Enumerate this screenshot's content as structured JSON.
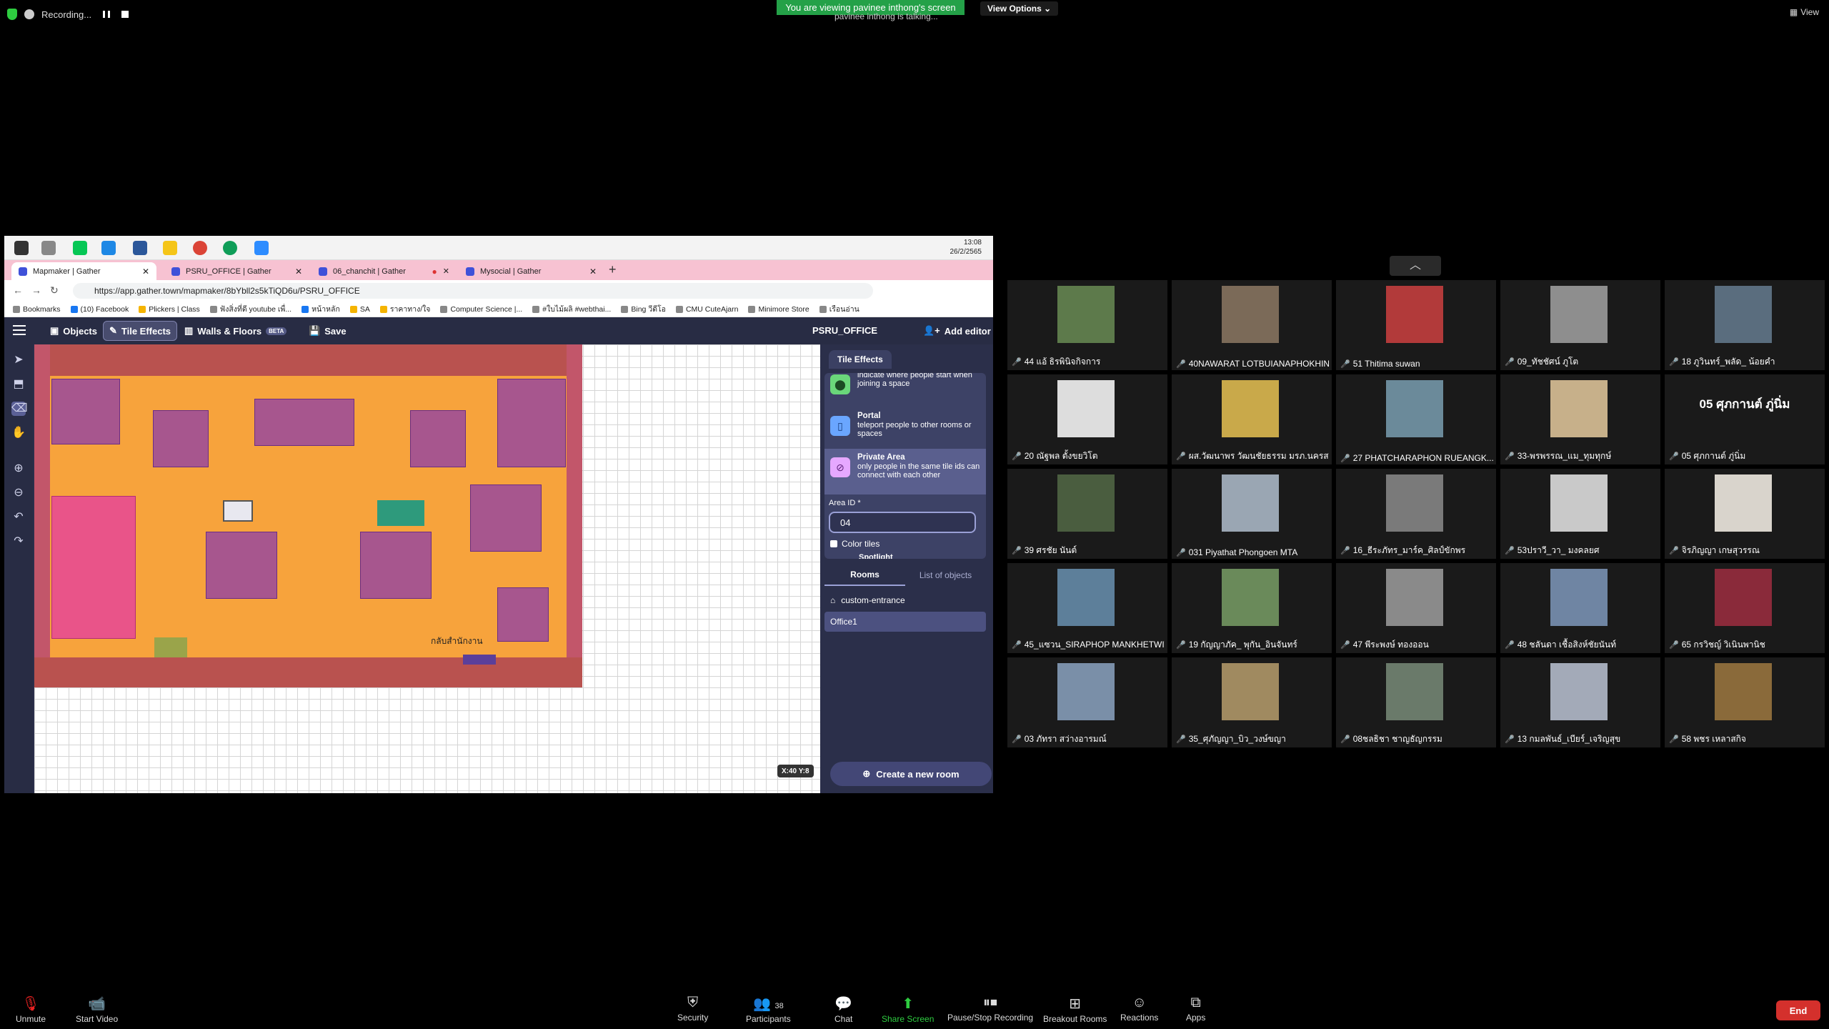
{
  "recording": {
    "label": "Recording..."
  },
  "banner": {
    "viewing": "You are viewing pavinee inthong's screen",
    "talking": "pavinee inthong is talking...",
    "view_options": "View Options ⌄",
    "view": "View"
  },
  "taskbar": {
    "time": "13:08",
    "date": "26/2/2565"
  },
  "browser": {
    "tabs": [
      {
        "label": "Mapmaker | Gather"
      },
      {
        "label": "PSRU_OFFICE | Gather"
      },
      {
        "label": "06_chanchit | Gather"
      },
      {
        "label": "Mysocial | Gather"
      }
    ],
    "url": "https://app.gather.town/mapmaker/8bYbll2s5kTiQD6u/PSRU_OFFICE",
    "bookmarks": [
      "Bookmarks",
      "(10) Facebook",
      "Plickers | Class",
      "ฟังสิ่งที่ดี youtube เพื่...",
      "หน้าหลัก",
      "SA",
      "ราคาทาง/ใจ",
      "Computer Science |...",
      "#ใบไม้ผลิ #webthai...",
      "Bing วีดีโอ",
      "CMU CuteAjarn",
      "Minimore Store",
      "เรือนอ่าน"
    ]
  },
  "gather": {
    "toolbar": {
      "objects": "Objects",
      "tile_effects": "Tile Effects",
      "walls_floors": "Walls & Floors",
      "beta": "BETA",
      "save": "Save",
      "space_name": "PSRU_OFFICE",
      "add_editor": "Add editor"
    },
    "panel": {
      "tab": "Tile Effects",
      "effects": [
        {
          "name": "",
          "desc": "indicate where people start when joining a space"
        },
        {
          "name": "Portal",
          "desc": "teleport people to other rooms or spaces"
        },
        {
          "name": "Private Area",
          "desc": "only people in the same tile ids can connect with each other"
        }
      ],
      "area_label": "Area ID *",
      "area_value": "04",
      "color_tiles": "Color tiles",
      "spotlight": "Spotlight",
      "rooms_tab": "Rooms",
      "objects_tab": "List of objects",
      "rooms": [
        "custom-entrance",
        "Office1"
      ],
      "create_room": "Create a new room"
    },
    "map": {
      "room_label": "กลับสำนักงาน",
      "coord": "X:40  Y:8"
    }
  },
  "participants": [
    "44 แอ้ ธิรพินิจกิจการ",
    "40NAWARAT LOTBUIANAPHOKHIN",
    "51 Thitima suwan",
    "09_ทัชชัศน์ ภูโต",
    "18 ภูวินทร์_พลัด_ น้อยคำ",
    "20 ณัฐพล ตั้งขยวิโต",
    "ผส.วัฒนาพร วัฒนชัยธรรม มรภ.นครส...",
    "27 PHATCHARAPHON RUEANGK...",
    "33-พรพรรณ_แม_ทุมทุกษ์",
    "05 ศุภกานต์ ภู่นิ่ม",
    "39 ศรชัย นันต์",
    "031 Piyathat Phongoen MTA",
    "16_ธีระภัทร_มาร์ค_ศิลป์ขักพร",
    "53ปราวี_วา_ มงคลยศ",
    "จิรภิญญา เกษสุวรรณ",
    "45_แซวน_SIRAPHOP MANKHETWIT",
    "19 กัญญาภัค_ พุกัน_อินจันทร์",
    "47 พีระพงษ์ ทองออน",
    "48 ชลันดา เชื้อสิงห์ชัยนันท์",
    "65 กรวิชญ์ วิเนินพานิช",
    "03 ภัทรา สว่างอารมณ์",
    "35_ศุภัญญา_บิว_วงษ์ขญา",
    "08ชลธิชา ชาญธัญกรรม",
    "13 กมลพันธ์_เบียร์_เจริญสุข",
    "58 พชร เหลาสกิจ"
  ],
  "no_video_name": "05 ศุภกานต์ ภู่นิ่ม",
  "bottom": {
    "unmute": "Unmute",
    "start_video": "Start Video",
    "security": "Security",
    "participants": "Participants",
    "participants_count": "38",
    "chat": "Chat",
    "share_screen": "Share Screen",
    "pause_recording": "Pause/Stop Recording",
    "breakout": "Breakout Rooms",
    "reactions": "Reactions",
    "apps": "Apps",
    "end": "End"
  }
}
